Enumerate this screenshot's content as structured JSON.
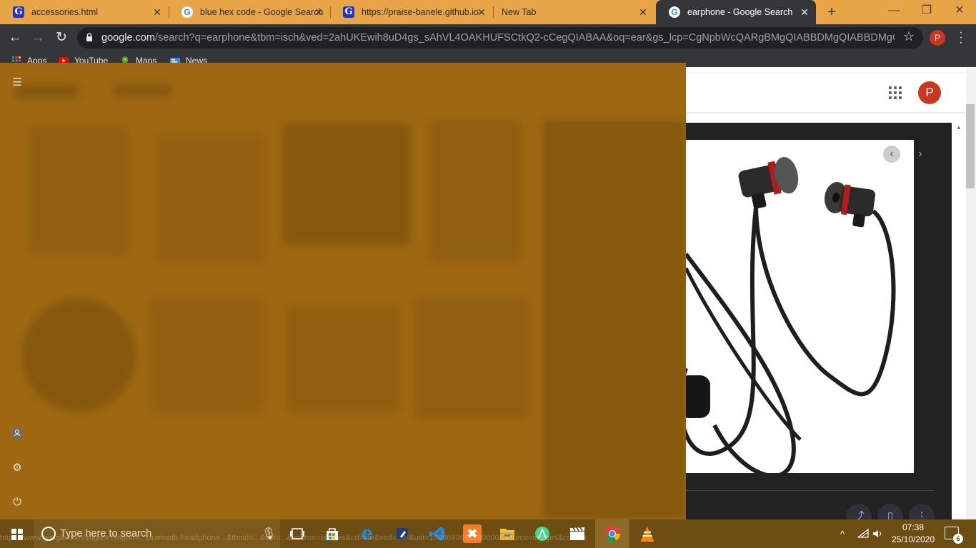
{
  "tabs": [
    {
      "title": "accessories.html",
      "favicon": "g-site-icon"
    },
    {
      "title": "blue hex code - Google Search",
      "favicon": "google-icon"
    },
    {
      "title": "https://praise-banele.github.io",
      "favicon": "g-site-icon"
    },
    {
      "title": "New Tab",
      "favicon": ""
    },
    {
      "title": "earphone - Google Search",
      "favicon": "google-icon",
      "active": true
    }
  ],
  "toolbar": {
    "url_host": "google.com",
    "url_path": "/search?q=earphone&tbm=isch&ved=2ahUKEwih8uD4gs_sAhVL4OAKHUFSCtkQ2-cCegQIABAA&oq=ear&gs_lcp=CgNpbWcQARgBMgQIABBDMgQIABBDMgQIABB...",
    "profile_initial": "P"
  },
  "bookmarks": [
    {
      "label": "Apps",
      "icon": "apps-grid-icon"
    },
    {
      "label": "YouTube",
      "icon": "youtube-icon"
    },
    {
      "label": "Maps",
      "icon": "maps-icon"
    },
    {
      "label": "News",
      "icon": "news-icon"
    }
  ],
  "page": {
    "avatar_initial": "P",
    "status_url": "https://www.google.com/imgres?imgurl=...bluetooth-headphone...&tbnid=...&vet=...&source=images&cd=vfe&ved=...H&ust=1603690652180000&source=images&cd=vfe"
  },
  "taskbar": {
    "search_placeholder": "Type here to search",
    "apps": [
      "task-view-icon",
      "store-icon",
      "edge-icon",
      "notes-icon",
      "vscode-icon",
      "xampp-icon",
      "file-explorer-icon",
      "android-studio-icon",
      "clapper-icon",
      "chrome-icon",
      "vlc-icon"
    ],
    "time": "07:38",
    "date": "25/10/2020",
    "notification_count": "6"
  },
  "colors": {
    "tabstrip": "#e8a547",
    "chrome_dark": "#35363a",
    "overlay": "#9e6812",
    "taskbar": "#6e4d12",
    "avatar": "#c8371e"
  }
}
